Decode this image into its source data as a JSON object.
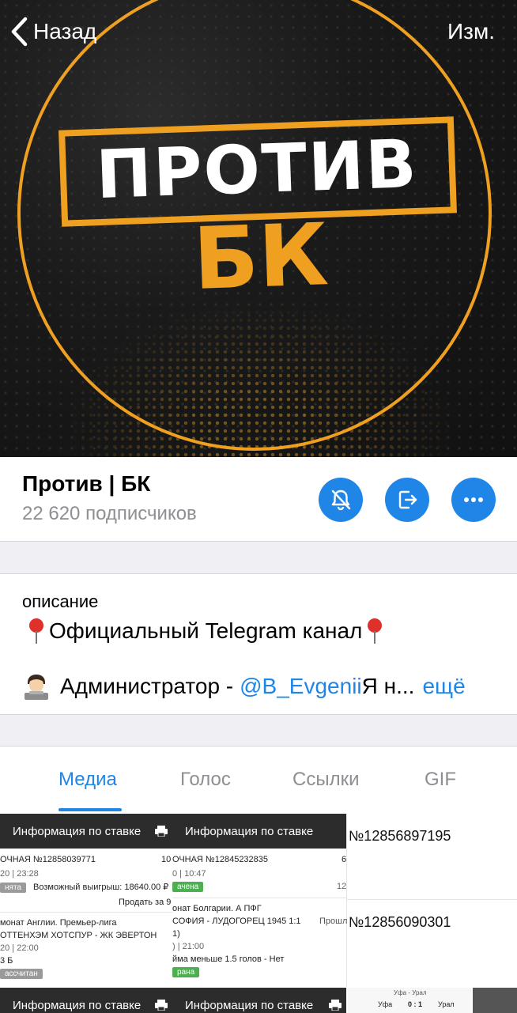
{
  "nav": {
    "back_label": "Назад",
    "edit_label": "Изм."
  },
  "cover": {
    "line1": "ПРОТИВ",
    "line2": "БК"
  },
  "channel": {
    "title": "Против | БК",
    "subscribers": "22 620 подписчиков"
  },
  "description": {
    "label": "описание",
    "line1_text": "Официальный Telegram канал",
    "line2_prefix": "Администратор -",
    "line2_mention": "@B_Evgenii",
    "line2_suffix": "Я н...",
    "more_label": "ещё"
  },
  "tabs": [
    {
      "label": "Медиа",
      "active": true
    },
    {
      "label": "Голос",
      "active": false
    },
    {
      "label": "Ссылки",
      "active": false
    },
    {
      "label": "GIF",
      "active": false
    }
  ],
  "media": {
    "header_label": "Информация по ставке",
    "tile1": {
      "l1": "ОЧНАЯ №12858039771",
      "l1b": "10",
      "l2": "20 | 23:28",
      "tag": "нята",
      "win": "Возможный выигрыш: 18640.00 ₽",
      "sell": "Продать за 9",
      "league": "монат Англии. Премьер-лига",
      "match": "ОТТЕНХЭМ ХОТСПУР - ЖК ЭВЕРТОН",
      "date": "20 | 22:00",
      "bet": "3 Б",
      "tag2": "ассчитан"
    },
    "tile2": {
      "l1": "ОЧНАЯ №12845232835",
      "l1b": "6",
      "l2": "0 | 10:47",
      "tag": "ачена",
      "num": "12",
      "league": "онат Болгарии. А ПФГ",
      "match": "СОФИЯ - ЛУДОГОРЕЦ 1945 1:1",
      "match2": "1)",
      "date": ") | 21:00",
      "bet": "йма меньше 1.5 голов - Нет",
      "tag2": "рана"
    },
    "ticket1": "№12856897195",
    "ticket2": "№12856090301",
    "ticket2_prefix": "Прошл",
    "score_left": "Уфа",
    "score": "0 : 1",
    "score_right": "Урал"
  }
}
